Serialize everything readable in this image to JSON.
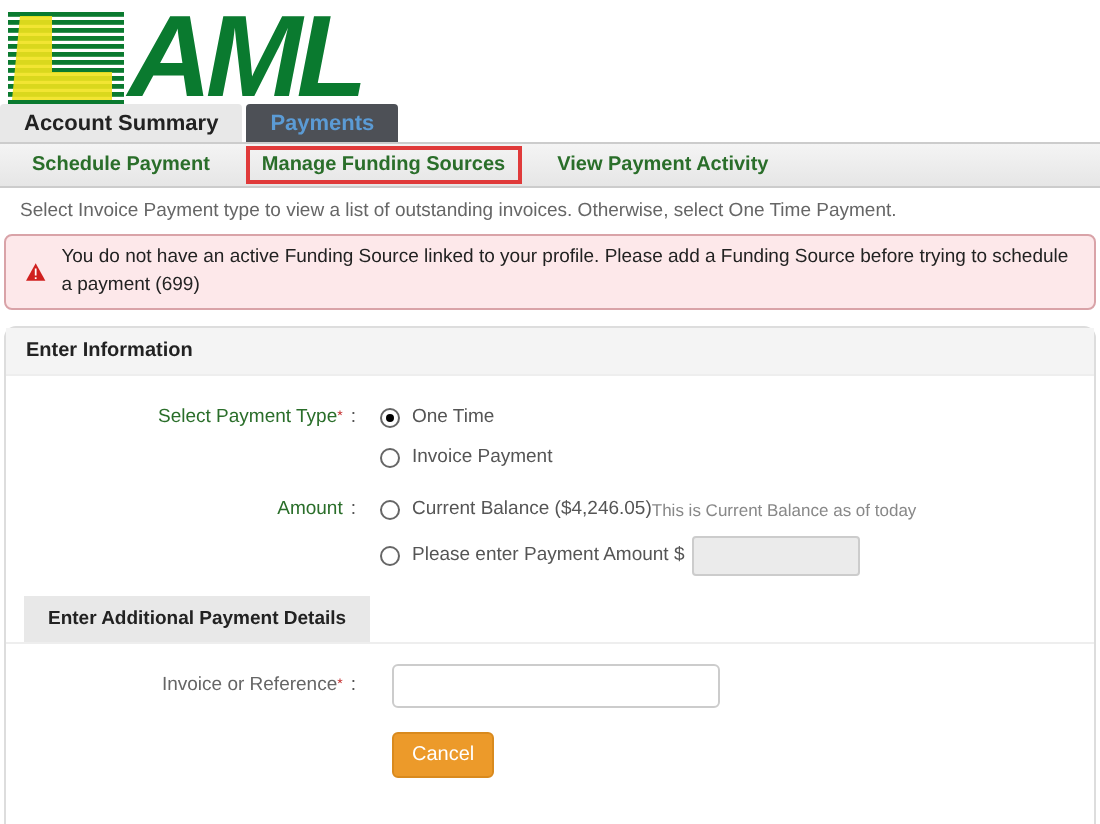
{
  "logo": {
    "text": "AML"
  },
  "tabs": [
    {
      "label": "Account Summary",
      "selected": false
    },
    {
      "label": "Payments",
      "selected": true
    }
  ],
  "subnav": [
    {
      "label": "Schedule Payment",
      "highlighted": false
    },
    {
      "label": "Manage Funding Sources",
      "highlighted": true
    },
    {
      "label": "View Payment Activity",
      "highlighted": false
    }
  ],
  "intro": "Select Invoice Payment type to view a list of outstanding invoices. Otherwise, select One Time Payment.",
  "alert": {
    "message": "You do not have an active Funding Source linked to your profile. Please add a Funding Source before trying to schedule a payment (699)"
  },
  "section": {
    "title": "Enter Information",
    "payment_type": {
      "label": "Select Payment Type",
      "required_mark": "*",
      "separator": ":",
      "options": [
        {
          "label": "One Time",
          "selected": true
        },
        {
          "label": "Invoice Payment",
          "selected": false
        }
      ]
    },
    "amount": {
      "label": "Amount",
      "separator": ":",
      "options": [
        {
          "kind": "balance",
          "label": "Current Balance ($4,246.05)",
          "note": "This is Current Balance as of today",
          "selected": false
        },
        {
          "kind": "input",
          "label": "Please enter Payment Amount $",
          "selected": false,
          "disabled": true
        }
      ]
    }
  },
  "details": {
    "title": "Enter Additional Payment Details",
    "reference": {
      "label": "Invoice or Reference",
      "required_mark": "*",
      "separator": ":"
    }
  },
  "buttons": [
    {
      "label": "Cancel"
    }
  ]
}
